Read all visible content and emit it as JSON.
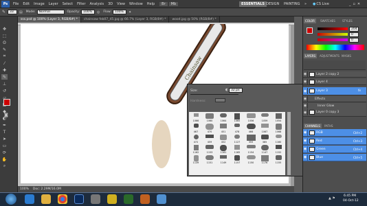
{
  "menubar": {
    "logo": "Ps",
    "items": [
      "File",
      "Edit",
      "Image",
      "Layer",
      "Select",
      "Filter",
      "Analysis",
      "3D",
      "View",
      "Window",
      "Help"
    ],
    "workspaces": [
      "ESSENTIALS",
      "DESIGN",
      "PAINTING",
      "»"
    ],
    "cslive": "CS Live"
  },
  "options": {
    "size": "33",
    "mode_label": "Mode:",
    "mode_value": "Normal",
    "opacity_label": "Opacity:",
    "opacity_value": "100%",
    "flow_label": "Flow:",
    "flow_value": "100%"
  },
  "doc_tabs": [
    {
      "label": "sss.psd @ 100% (Layer 3, RGB/8#) *",
      "active": true
    },
    {
      "label": "chainsaw feb07_45.jpg @ 66.7% (Layer 3, RGB/8#) *",
      "active": false
    },
    {
      "label": "wood.jpg @ 50% (RGB/8#) *",
      "active": false
    }
  ],
  "status": {
    "zoom": "100%",
    "doc": "Doc: 2.29M/16.0M"
  },
  "brush_picker": {
    "size_label": "Size:",
    "size_value": "32 px",
    "hardness_label": "Hardness:",
    "brush_numbers": [
      "1066",
      "1060",
      "1064",
      "1065",
      "1056",
      "1059",
      "1054",
      "467",
      "470",
      "451",
      "478",
      "466",
      "1067",
      "1068",
      "472",
      "459",
      "452",
      "1127",
      "355",
      "385",
      "1160",
      "1162",
      "1153",
      "1161",
      "1165",
      "1154",
      "1147",
      "1152",
      "1139",
      "1151",
      "1149",
      "1157",
      "1150",
      "1176",
      "1155"
    ]
  },
  "color_panel": {
    "tabs": [
      "COLOR",
      "SWATCHES",
      "STYLES"
    ],
    "r": "204",
    "g": "0",
    "b": "0",
    "fg_color": "#cc0000",
    "bg_color": "#ffffff"
  },
  "layers_panel": {
    "tabs": [
      "LAYERS",
      "ADJUSTMENTS",
      "MASKS"
    ],
    "layers": [
      {
        "name": "Layer 2 copy 2",
        "selected": false
      },
      {
        "name": "Layer 4",
        "selected": false
      },
      {
        "name": "Layer 3",
        "selected": true,
        "fx": "fx"
      },
      {
        "name": "Effects",
        "selected": false
      },
      {
        "name": "Inner Glow",
        "selected": false
      },
      {
        "name": "Layer 0 copy 3",
        "selected": false
      }
    ]
  },
  "channels_panel": {
    "tabs": [
      "CHANNELS",
      "PATHS"
    ],
    "channels": [
      {
        "name": "RGB",
        "shortcut": "Ctrl+2"
      },
      {
        "name": "Red",
        "shortcut": "Ctrl+3"
      },
      {
        "name": "Green",
        "shortcut": "Ctrl+4"
      },
      {
        "name": "Blue",
        "shortcut": "Ctrl+5"
      }
    ]
  },
  "taskbar": {
    "time": "6:45 PM",
    "date": "04-Oct-12"
  }
}
